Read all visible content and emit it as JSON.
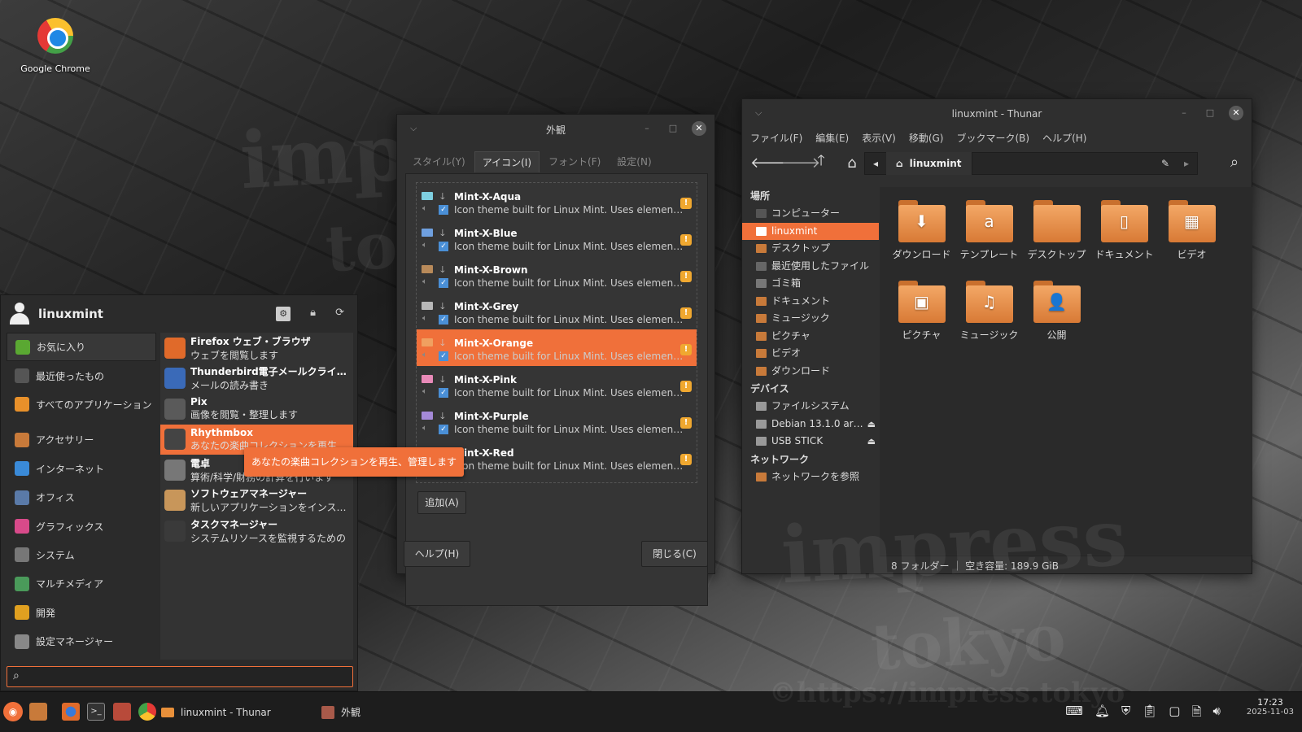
{
  "desktop": {
    "chrome_label": "Google Chrome",
    "watermark_big": "impress",
    "watermark_small": "tokyo",
    "watermark_url": "©https://impress.tokyo"
  },
  "appearance": {
    "title": "外観",
    "tabs": [
      "スタイル(Y)",
      "アイコン(I)",
      "フォント(F)",
      "設定(N)"
    ],
    "active_tab": 1,
    "themes": [
      {
        "name": "Mint-X-Aqua",
        "desc": "Icon theme built for Linux Mint. Uses elementary",
        "color": "#7ecfe0"
      },
      {
        "name": "Mint-X-Blue",
        "desc": "Icon theme built for Linux Mint. Uses elementary",
        "color": "#6fa0e0"
      },
      {
        "name": "Mint-X-Brown",
        "desc": "Icon theme built for Linux Mint. Uses elementary",
        "color": "#b88a5a"
      },
      {
        "name": "Mint-X-Grey",
        "desc": "Icon theme built for Linux Mint. Uses elementary",
        "color": "#b8b8b8"
      },
      {
        "name": "Mint-X-Orange",
        "desc": "Icon theme built for Linux Mint. Uses elementary",
        "color": "#f0a060"
      },
      {
        "name": "Mint-X-Pink",
        "desc": "Icon theme built for Linux Mint. Uses elementary",
        "color": "#e88ab8"
      },
      {
        "name": "Mint-X-Purple",
        "desc": "Icon theme built for Linux Mint. Uses elementary",
        "color": "#a58ad8"
      },
      {
        "name": "Mint-X-Red",
        "desc": "Icon theme built for Linux Mint. Uses elementary",
        "color": "#e06060"
      }
    ],
    "selected_theme": 4,
    "add_label": "追加(A)",
    "help_label": "ヘルプ(H)",
    "close_label": "閉じる(C)"
  },
  "thunar": {
    "title": "linuxmint - Thunar",
    "menus": [
      "ファイル(F)",
      "編集(E)",
      "表示(V)",
      "移動(G)",
      "ブックマーク(B)",
      "ヘルプ(H)"
    ],
    "path": "linuxmint",
    "places_header": "場所",
    "places": [
      "コンピューター",
      "linuxmint",
      "デスクトップ",
      "最近使用したファイル",
      "ゴミ箱",
      "ドキュメント",
      "ミュージック",
      "ピクチャ",
      "ビデオ",
      "ダウンロード"
    ],
    "selected_place": 1,
    "devices_header": "デバイス",
    "devices": [
      "ファイルシステム",
      "Debian 13.1.0 ar…",
      "USB STICK"
    ],
    "network_header": "ネットワーク",
    "network": [
      "ネットワークを参照"
    ],
    "folders": [
      {
        "label": "ダウンロード",
        "emblem": "⬇"
      },
      {
        "label": "テンプレート",
        "emblem": "a"
      },
      {
        "label": "デスクトップ",
        "emblem": ""
      },
      {
        "label": "ドキュメント",
        "emblem": "▯"
      },
      {
        "label": "ビデオ",
        "emblem": "▦"
      },
      {
        "label": "ピクチャ",
        "emblem": "▣"
      },
      {
        "label": "ミュージック",
        "emblem": "♫"
      },
      {
        "label": "公開",
        "emblem": "👤"
      }
    ],
    "status": "8 フォルダー ｜ 空き容量: 189.9 GiB"
  },
  "menu": {
    "user": "linuxmint",
    "categories": [
      {
        "label": "お気に入り",
        "color": "#5aa832"
      },
      {
        "label": "最近使ったもの",
        "color": "#555555"
      },
      {
        "label": "すべてのアプリケーション",
        "color": "#e8902a"
      },
      {
        "label": "アクセサリー",
        "color": "#c87a3a"
      },
      {
        "label": "インターネット",
        "color": "#3a8ad8"
      },
      {
        "label": "オフィス",
        "color": "#5a7aa8"
      },
      {
        "label": "グラフィックス",
        "color": "#d84a8a"
      },
      {
        "label": "システム",
        "color": "#777777"
      },
      {
        "label": "マルチメディア",
        "color": "#4a9a5a"
      },
      {
        "label": "開発",
        "color": "#e0a020"
      },
      {
        "label": "設定マネージャー",
        "color": "#888888"
      }
    ],
    "selected_category": 0,
    "apps": [
      {
        "title": "Firefox ウェブ・ブラウザ",
        "desc": "ウェブを閲覧します",
        "color": "#e06a2a"
      },
      {
        "title": "Thunderbird電子メールクライアント",
        "desc": "メールの読み書き",
        "color": "#3a6ab8"
      },
      {
        "title": "Pix",
        "desc": "画像を閲覧・整理します",
        "color": "#5a5a5a"
      },
      {
        "title": "Rhythmbox",
        "desc": "あなたの楽曲コレクションを再生",
        "color": "#444444"
      },
      {
        "title": "電卓",
        "desc": "算術/科学/財務の計算を行います",
        "color": "#777777"
      },
      {
        "title": "ソフトウェアマネージャー",
        "desc": "新しいアプリケーションをインストール",
        "color": "#c8965a"
      },
      {
        "title": "タスクマネージャー",
        "desc": "システムリソースを監視するための",
        "color": "#3a3a3a"
      }
    ],
    "selected_app": 3,
    "tooltip": "あなたの楽曲コレクションを再生、管理します",
    "search_value": ""
  },
  "panel": {
    "tasks": [
      "linuxmint - Thunar",
      "外観"
    ],
    "time": "17:23",
    "date": "2025-11-03"
  }
}
